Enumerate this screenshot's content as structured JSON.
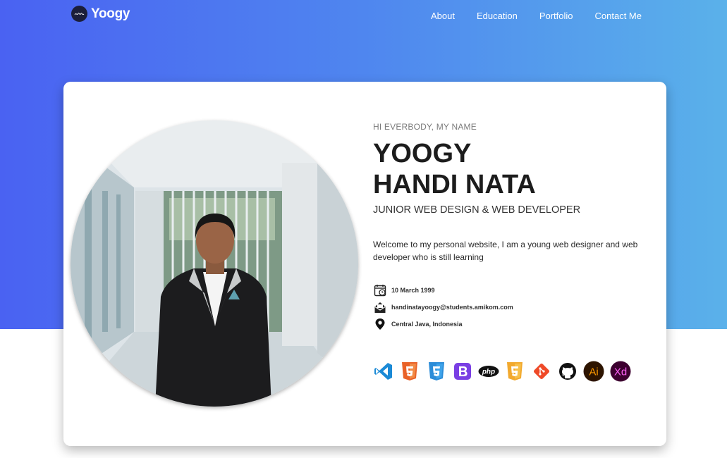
{
  "nav": {
    "brand": "Yoogy",
    "logo_text": "yh",
    "links": [
      "About",
      "Education",
      "Portfolio",
      "Contact Me"
    ]
  },
  "profile": {
    "greeting": "HI EVERBODY, MY NAME",
    "name_line1": "YOOGY",
    "name_line2": "HANDI NATA",
    "role": "JUNIOR WEB DESIGN & WEB DEVELOPER",
    "welcome": "Welcome to my personal website, I am a young web designer and web developer who is still learning",
    "birthdate": "10 March 1999",
    "email": "handinatayoogy@students.amikom.com",
    "location": "Central Java, Indonesia"
  },
  "skills": {
    "vscode": "vscode-icon",
    "html5": "html5-icon",
    "css3": "css3-icon",
    "bootstrap": "bootstrap-icon",
    "php": "php",
    "js": "javascript-icon",
    "git": "git-icon",
    "github": "github-icon",
    "ai": "Ai",
    "xd": "Xd"
  },
  "colors": {
    "gradient_start": "#4a62f2",
    "gradient_end": "#5ab1ea",
    "vscode": "#1b8ad6",
    "html5": "#e96228",
    "css3": "#2b8cd8",
    "bootstrap": "#7a3fe4",
    "php": "#111111",
    "js": "#f2a92e",
    "git": "#ef4a28",
    "ai": "#2d1400",
    "xd": "#3d0030"
  }
}
